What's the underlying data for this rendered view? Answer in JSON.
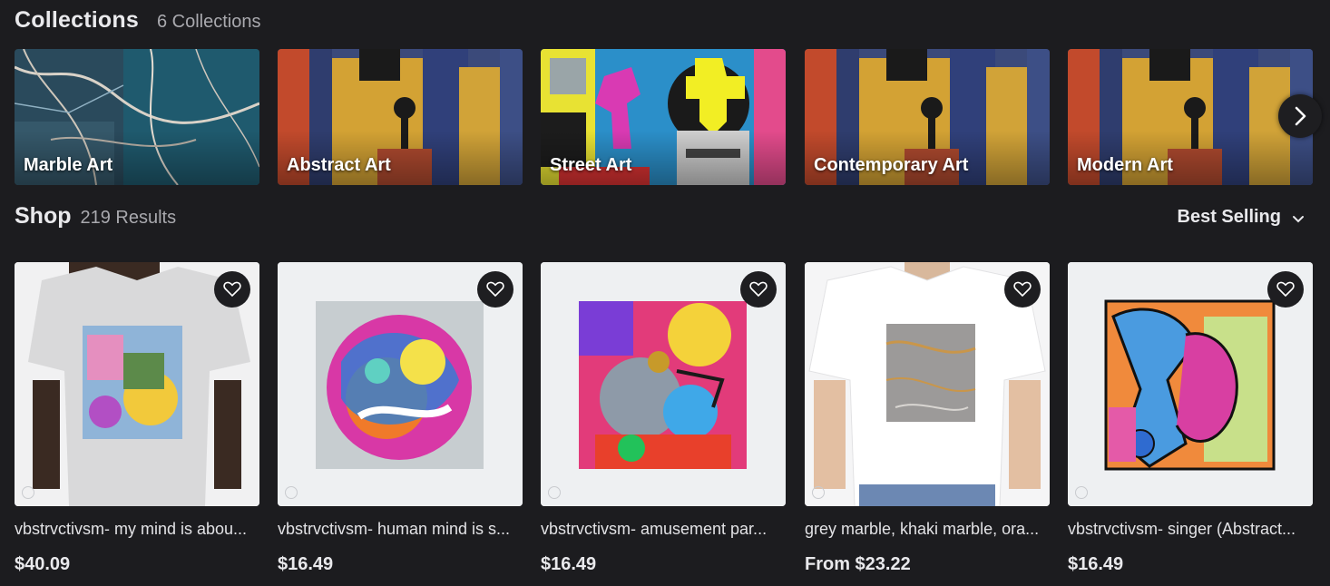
{
  "collections": {
    "title": "Collections",
    "count": "6 Collections",
    "items": [
      {
        "label": "Marble Art"
      },
      {
        "label": "Abstract Art"
      },
      {
        "label": "Street Art"
      },
      {
        "label": "Contemporary Art"
      },
      {
        "label": "Modern Art"
      }
    ],
    "next_icon": "chevron-right-icon"
  },
  "shop": {
    "title": "Shop",
    "count": "219 Results",
    "sort_label": "Best Selling",
    "sort_icon": "chevron-down-icon",
    "products": [
      {
        "title": "vbstrvctivsm- my mind is abou...",
        "price": "$40.09"
      },
      {
        "title": "vbstrvctivsm- human mind is s...",
        "price": "$16.49"
      },
      {
        "title": "vbstrvctivsm- amusement par...",
        "price": "$16.49"
      },
      {
        "title": "grey marble, khaki marble, ora...",
        "price": "From $23.22"
      },
      {
        "title": "vbstrvctivsm- singer (Abstract...",
        "price": "$16.49"
      }
    ]
  },
  "colors": {
    "background": "#1c1c1f",
    "text": "#e9e9ec",
    "muted": "#a9a9ae"
  }
}
